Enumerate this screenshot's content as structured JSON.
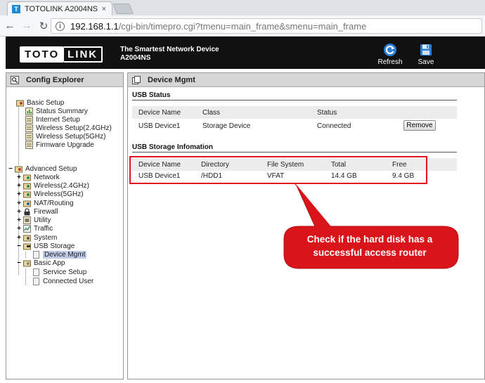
{
  "browser": {
    "tab_title": "TOTOLINK A2004NS",
    "tab_close": "×",
    "tab_logo": "T",
    "url_host": "192.168.1.1",
    "url_path": "/cgi-bin/timepro.cgi?tmenu=main_frame&smenu=main_frame"
  },
  "header": {
    "logo_left": "TOTO",
    "logo_right": "LINK",
    "tagline_line1": "The Smartest Network Device",
    "tagline_line2": "A2004NS",
    "refresh_label": "Refresh",
    "save_label": "Save"
  },
  "sidebar": {
    "title": "Config Explorer",
    "basic_setup": {
      "label": "Basic Setup",
      "items": [
        "Status Summary",
        "Internet Setup",
        "Wireless Setup(2.4GHz)",
        "Wireless Setup(5GHz)",
        "Firmware Upgrade"
      ]
    },
    "advanced_setup": {
      "label": "Advanced Setup",
      "items": [
        "Network",
        "Wireless(2.4GHz)",
        "Wireless(5GHz)",
        "NAT/Routing",
        "Firewall",
        "Utility",
        "Traffic",
        "System",
        "USB Storage"
      ],
      "usb_child": "Device Mgmt",
      "basic_app": "Basic App",
      "basic_app_items": [
        "Service Setup",
        "Connected User"
      ]
    },
    "expand_plus": "+",
    "expand_minus": "−"
  },
  "main": {
    "title": "Device Mgmt",
    "usb_status": {
      "title": "USB Status",
      "headers": [
        "Device Name",
        "Class",
        "Status"
      ],
      "row": [
        "USB Device1",
        "Storage Device",
        "Connected"
      ],
      "remove_label": "Remove"
    },
    "usb_storage": {
      "title": "USB Storage Infomation",
      "headers": [
        "Device Name",
        "Directory",
        "File System",
        "Total",
        "Free"
      ],
      "row": [
        "USB Device1",
        "/HDD1",
        "VFAT",
        "14.4 GB",
        "9.4 GB"
      ]
    }
  },
  "annotation": {
    "line1": "Check if the hard disk has a",
    "line2": "successful access router",
    "color": "#e3141b"
  }
}
